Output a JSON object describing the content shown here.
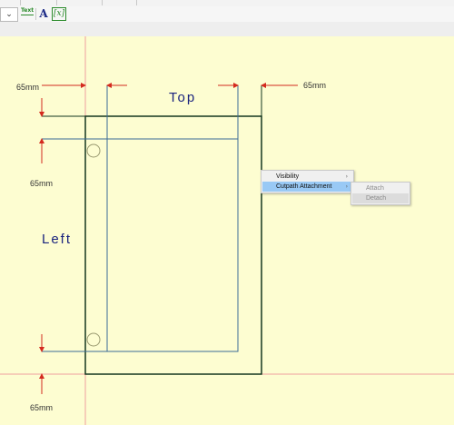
{
  "toolbar": {
    "dropdown_glyph": "⌄",
    "text_tool_glyph": "Text",
    "font_tool_glyph": "A",
    "variable_tool_glyph": "[x]"
  },
  "drawing": {
    "top_label": "Top",
    "left_label": "Left",
    "margin_top_left": "65mm",
    "margin_top_right": "65mm",
    "margin_left_upper": "65mm",
    "margin_bottom": "65mm"
  },
  "context_menu": {
    "items": [
      {
        "label": "Visibility",
        "has_submenu": true
      },
      {
        "label": "Cutpath Attachment",
        "has_submenu": true
      }
    ],
    "submenu_arrow": "›",
    "submenu": {
      "items": [
        {
          "label": "Attach"
        },
        {
          "label": "Detach"
        }
      ]
    }
  },
  "colors": {
    "canvas": "#fdfdd1",
    "outer_frame": "#14371f",
    "inner_frame": "#3c6a96",
    "arrow": "#d42a1e",
    "guide": "#f0a0a0",
    "menu_highlight": "#99c9f5"
  }
}
